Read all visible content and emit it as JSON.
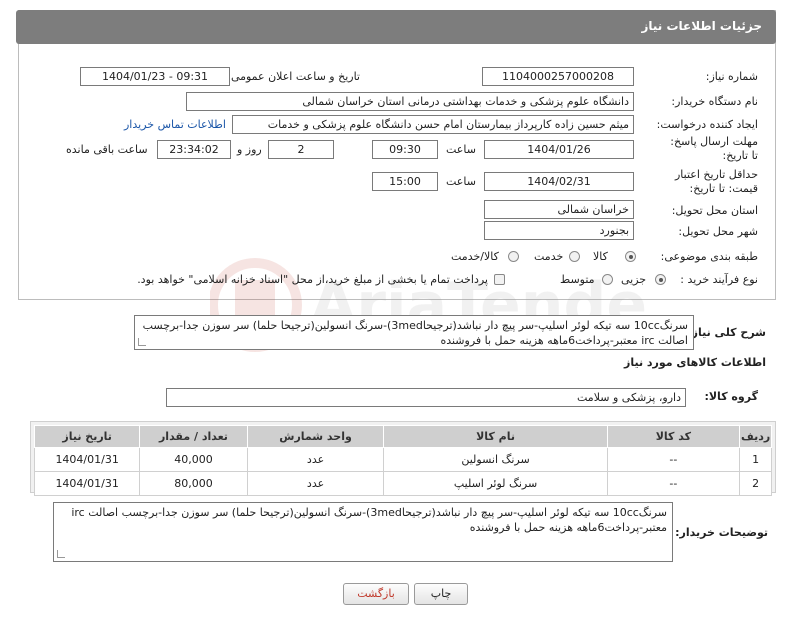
{
  "header": {
    "title": "جزئیات اطلاعات نیاز"
  },
  "fields": {
    "need_number_label": "شماره نیاز:",
    "need_number": "1104000257000208",
    "announce_label": "تاریخ و ساعت اعلان عمومی:",
    "announce_value": "1404/01/23 - 09:31",
    "buyer_org_label": "نام دستگاه خریدار:",
    "buyer_org": "دانشگاه علوم پزشکی و خدمات بهداشتی درمانی استان خراسان شمالی",
    "requester_label": "ایجاد کننده درخواست:",
    "requester": "میثم  حسین زاده  کارپرداز بیمارستان امام حسن دانشگاه علوم پزشکی و خدمات",
    "contact_link": "اطلاعات تماس خریدار",
    "deadline_label": "مهلت ارسال پاسخ: تا تاریخ:",
    "deadline_date": "1404/01/26",
    "time_label": "ساعت",
    "deadline_time": "09:30",
    "days_value": "2",
    "days_label": "روز و",
    "remaining_value": "23:34:02",
    "remaining_label": "ساعت باقی مانده",
    "validity_label": "حداقل تاریخ اعتبار قیمت: تا تاریخ:",
    "validity_date": "1404/02/31",
    "validity_time": "15:00",
    "province_label": "استان محل تحویل:",
    "province": "خراسان شمالی",
    "city_label": "شهر محل تحویل:",
    "city": "بجنورد",
    "category_label": "طبقه بندی موضوعی:",
    "category_options": [
      "کالا",
      "خدمت",
      "کالا/خدمت"
    ],
    "process_label": "نوع فرآیند خرید :",
    "process_options": [
      "جزیی",
      "متوسط"
    ],
    "process_note": "پرداخت تمام یا بخشی از مبلغ خرید،از محل \"اسناد خزانه اسلامی\" خواهد بود."
  },
  "description": {
    "label": "شرح کلی نیاز:",
    "text": "سرنگ10cc سه تیکه لوئر اسلیپ-سر پیچ دار نباشد(ترجیحا3med)-سرنگ انسولین(ترجیحا حلما) سر سوزن جدا-برچسب اصالت irc معتبر-پرداخت6ماهه هزینه حمل با فروشنده"
  },
  "goods": {
    "section_title": "اطلاعات کالاهای مورد نیاز",
    "group_label": "گروه کالا:",
    "group_value": "دارو، پزشکی و سلامت",
    "columns": [
      "ردیف",
      "کد کالا",
      "نام کالا",
      "واحد شمارش",
      "تعداد / مقدار",
      "تاریخ نیاز"
    ],
    "rows": [
      [
        "1",
        "--",
        "سرنگ انسولین",
        "عدد",
        "40,000",
        "1404/01/31"
      ],
      [
        "2",
        "--",
        "سرنگ لوئر اسلیپ",
        "عدد",
        "80,000",
        "1404/01/31"
      ]
    ]
  },
  "buyer_notes": {
    "label": "توضیحات خریدار:",
    "text": "سرنگ10cc سه تیکه لوئر اسلیپ-سر پیچ دار نباشد(ترجیحا3med)-سرنگ انسولین(ترجیحا حلما) سر سوزن جدا-برچسب اصالت irc معتبر-پرداخت6ماهه هزینه حمل با فروشنده"
  },
  "buttons": {
    "print": "چاپ",
    "back": "بازگشت"
  },
  "colors": {
    "header": "#7d7d7d",
    "link": "#1b56a8",
    "back_button_text": "#c0392b"
  }
}
